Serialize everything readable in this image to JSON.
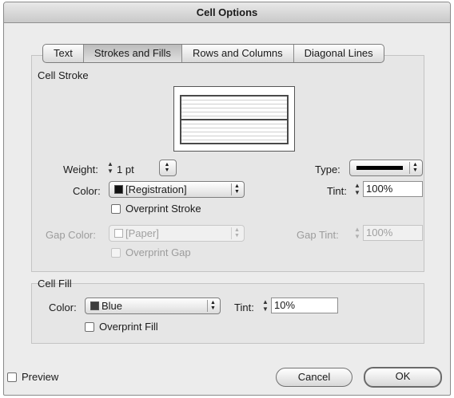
{
  "window": {
    "title": "Cell Options"
  },
  "tabs": [
    {
      "label": "Text",
      "active": false
    },
    {
      "label": "Strokes and Fills",
      "active": true
    },
    {
      "label": "Rows and Columns",
      "active": false
    },
    {
      "label": "Diagonal Lines",
      "active": false
    }
  ],
  "cell_stroke": {
    "title": "Cell Stroke",
    "weight_label": "Weight:",
    "weight_value": "1 pt",
    "type_label": "Type:",
    "color_label": "Color:",
    "color_value": "[Registration]",
    "tint_label": "Tint:",
    "tint_value": "100%",
    "overprint_stroke_label": "Overprint Stroke",
    "gap_color_label": "Gap Color:",
    "gap_color_value": "[Paper]",
    "gap_tint_label": "Gap Tint:",
    "gap_tint_value": "100%",
    "overprint_gap_label": "Overprint Gap"
  },
  "cell_fill": {
    "title": "Cell Fill",
    "color_label": "Color:",
    "color_value": "Blue",
    "tint_label": "Tint:",
    "tint_value": "10%",
    "overprint_fill_label": "Overprint Fill"
  },
  "footer": {
    "preview_label": "Preview",
    "cancel_label": "Cancel",
    "ok_label": "OK"
  },
  "colors": {
    "registration_swatch": "#111111",
    "paper_swatch": "#ffffff",
    "blue_swatch": "#3d3d3d"
  }
}
